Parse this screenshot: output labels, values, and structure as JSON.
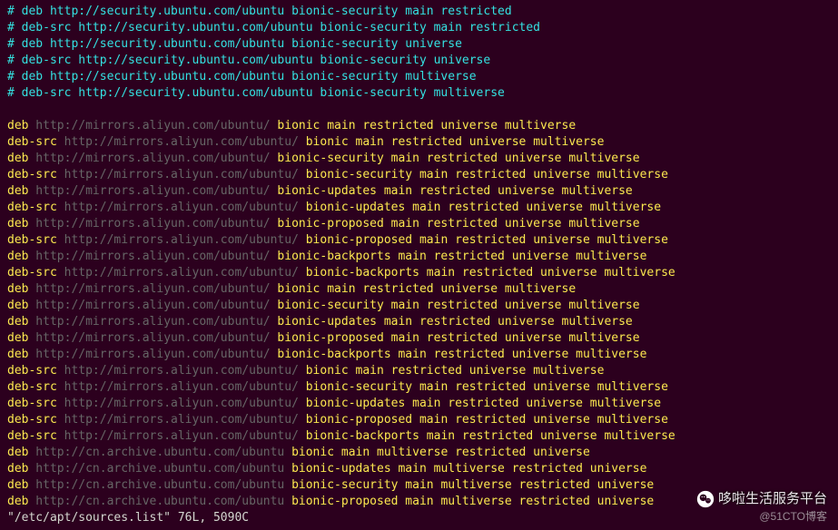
{
  "comments": [
    "# deb http://security.ubuntu.com/ubuntu bionic-security main restricted",
    "# deb-src http://security.ubuntu.com/ubuntu bionic-security main restricted",
    "# deb http://security.ubuntu.com/ubuntu bionic-security universe",
    "# deb-src http://security.ubuntu.com/ubuntu bionic-security universe",
    "# deb http://security.ubuntu.com/ubuntu bionic-security multiverse",
    "# deb-src http://security.ubuntu.com/ubuntu bionic-security multiverse"
  ],
  "entries": [
    {
      "type": "deb",
      "url": "http://mirrors.aliyun.com/ubuntu/",
      "rest": "bionic main restricted universe multiverse"
    },
    {
      "type": "deb-src",
      "url": "http://mirrors.aliyun.com/ubuntu/",
      "rest": "bionic main restricted universe multiverse"
    },
    {
      "type": "deb",
      "url": "http://mirrors.aliyun.com/ubuntu/",
      "rest": "bionic-security main restricted universe multiverse"
    },
    {
      "type": "deb-src",
      "url": "http://mirrors.aliyun.com/ubuntu/",
      "rest": "bionic-security main restricted universe multiverse"
    },
    {
      "type": "deb",
      "url": "http://mirrors.aliyun.com/ubuntu/",
      "rest": "bionic-updates main restricted universe multiverse"
    },
    {
      "type": "deb-src",
      "url": "http://mirrors.aliyun.com/ubuntu/",
      "rest": "bionic-updates main restricted universe multiverse"
    },
    {
      "type": "deb",
      "url": "http://mirrors.aliyun.com/ubuntu/",
      "rest": "bionic-proposed main restricted universe multiverse"
    },
    {
      "type": "deb-src",
      "url": "http://mirrors.aliyun.com/ubuntu/",
      "rest": "bionic-proposed main restricted universe multiverse"
    },
    {
      "type": "deb",
      "url": "http://mirrors.aliyun.com/ubuntu/",
      "rest": "bionic-backports main restricted universe multiverse"
    },
    {
      "type": "deb-src",
      "url": "http://mirrors.aliyun.com/ubuntu/",
      "rest": "bionic-backports main restricted universe multiverse"
    },
    {
      "type": "deb",
      "url": "http://mirrors.aliyun.com/ubuntu/",
      "rest": "bionic main restricted universe multiverse"
    },
    {
      "type": "deb",
      "url": "http://mirrors.aliyun.com/ubuntu/",
      "rest": "bionic-security main restricted universe multiverse"
    },
    {
      "type": "deb",
      "url": "http://mirrors.aliyun.com/ubuntu/",
      "rest": "bionic-updates main restricted universe multiverse"
    },
    {
      "type": "deb",
      "url": "http://mirrors.aliyun.com/ubuntu/",
      "rest": "bionic-proposed main restricted universe multiverse"
    },
    {
      "type": "deb",
      "url": "http://mirrors.aliyun.com/ubuntu/",
      "rest": "bionic-backports main restricted universe multiverse"
    },
    {
      "type": "deb-src",
      "url": "http://mirrors.aliyun.com/ubuntu/",
      "rest": "bionic main restricted universe multiverse"
    },
    {
      "type": "deb-src",
      "url": "http://mirrors.aliyun.com/ubuntu/",
      "rest": "bionic-security main restricted universe multiverse"
    },
    {
      "type": "deb-src",
      "url": "http://mirrors.aliyun.com/ubuntu/",
      "rest": "bionic-updates main restricted universe multiverse"
    },
    {
      "type": "deb-src",
      "url": "http://mirrors.aliyun.com/ubuntu/",
      "rest": "bionic-proposed main restricted universe multiverse"
    },
    {
      "type": "deb-src",
      "url": "http://mirrors.aliyun.com/ubuntu/",
      "rest": "bionic-backports main restricted universe multiverse"
    },
    {
      "type": "deb",
      "url": "http://cn.archive.ubuntu.com/ubuntu",
      "rest": "bionic main multiverse restricted universe"
    },
    {
      "type": "deb",
      "url": "http://cn.archive.ubuntu.com/ubuntu",
      "rest": "bionic-updates main multiverse restricted universe"
    },
    {
      "type": "deb",
      "url": "http://cn.archive.ubuntu.com/ubuntu",
      "rest": "bionic-security main multiverse restricted universe"
    },
    {
      "type": "deb",
      "url": "http://cn.archive.ubuntu.com/ubuntu",
      "rest": "bionic-proposed main multiverse restricted universe"
    }
  ],
  "status": "\"/etc/apt/sources.list\" 76L, 5090C",
  "watermark": "哆啦生活服务平台",
  "subwatermark": "@51CTO博客"
}
